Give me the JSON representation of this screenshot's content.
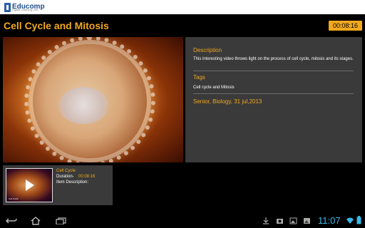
{
  "app": {
    "logo_text": "Educomp",
    "logo_sub": "Digital Learning, Life."
  },
  "header": {
    "title": "Cell Cycle and Mitosis",
    "duration": "00:08:16"
  },
  "details": {
    "description_heading": "Description",
    "description_text": "This interesting video throws light on the process of cell cycle, mitosis and its stages.",
    "tags_heading": "Tags",
    "tags_text": "Cell cycle and Mitosis",
    "meta": "Senior, Biology, 31 jul,2013"
  },
  "playlist": [
    {
      "title": "Cell Cycle",
      "duration_label": "Duration-",
      "duration": "00:08:16",
      "item_description_label": "Item Description:",
      "thumb_caption": "Cell Cycle"
    }
  ],
  "system": {
    "clock": "11:07",
    "accent": "#f2a81d",
    "clock_color": "#39b7e8"
  },
  "icons": [
    "back-icon",
    "home-icon",
    "recent-apps-icon",
    "download-icon",
    "camera-icon",
    "gallery-icon",
    "image-icon",
    "wifi-icon",
    "battery-icon"
  ]
}
